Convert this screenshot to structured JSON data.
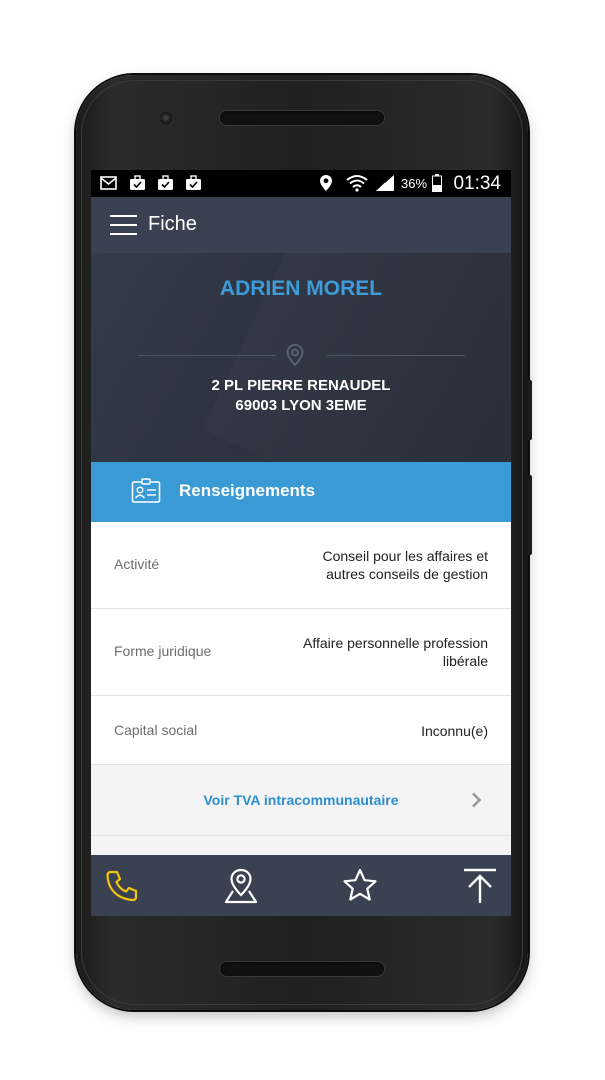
{
  "app": {
    "title": "Fiche"
  },
  "status_bar": {
    "time": "01:34",
    "battery": "36%"
  },
  "contact": {
    "name": "ADRIEN MOREL",
    "address_line1": "2 PL  PIERRE RENAUDEL",
    "address_line2": "69003 LYON 3EME"
  },
  "section": {
    "title": "Renseignements"
  },
  "rows": [
    {
      "label": "Activité",
      "value_line1": "Conseil pour les affaires et",
      "value_line2": "autres conseils de gestion"
    },
    {
      "label": "Forme juridique",
      "value_line1": "Affaire personnelle profession",
      "value_line2": "libérale"
    },
    {
      "label": "Capital social",
      "value": "Inconnu(e)"
    }
  ],
  "tva_link": {
    "label": "Voir TVA intracommunautaire"
  },
  "bottom_nav": {
    "items": [
      {
        "icon": "phone-icon"
      },
      {
        "icon": "location-icon"
      },
      {
        "icon": "star-icon"
      },
      {
        "icon": "share-icon"
      }
    ]
  },
  "colors": {
    "accent": "#3a9ad6",
    "name_blue": "#3b9ad9",
    "appbar": "#3a4150",
    "phone_icon": "#f2c40f"
  }
}
